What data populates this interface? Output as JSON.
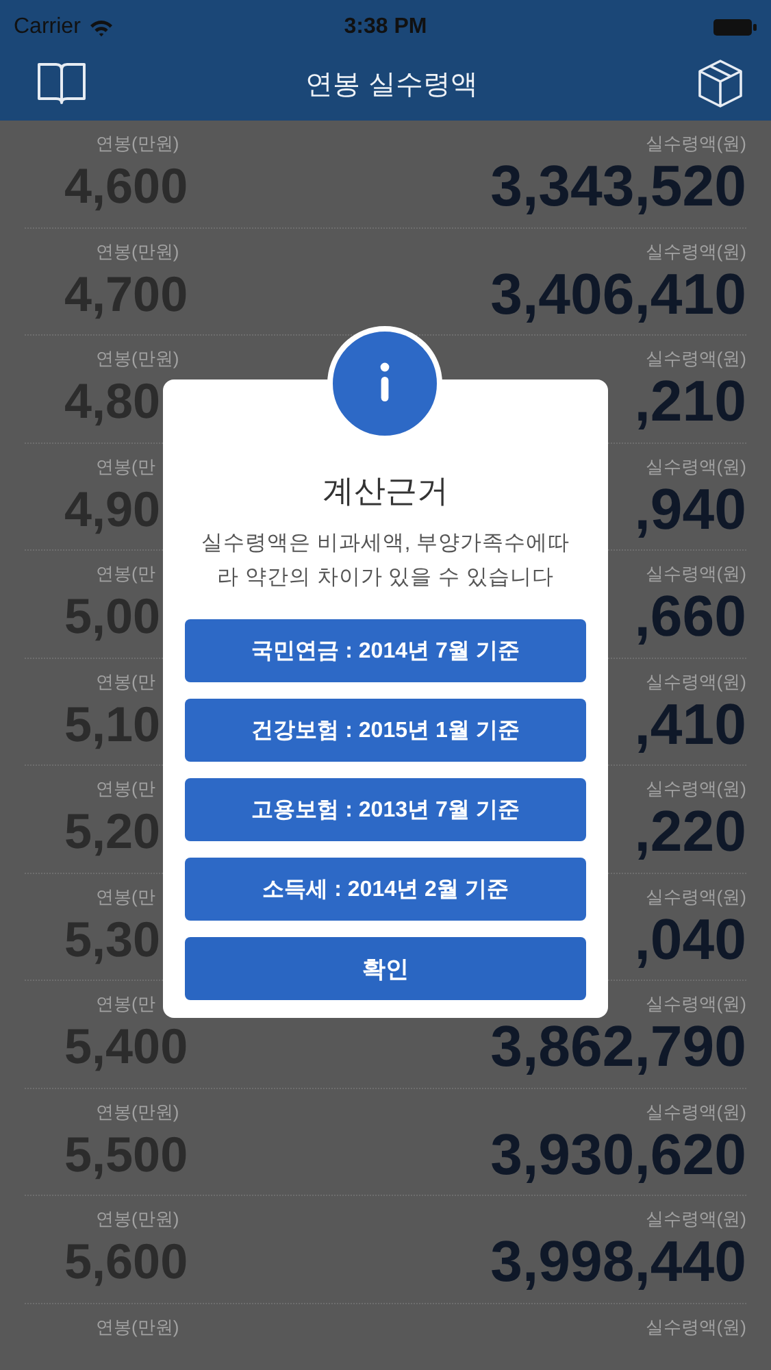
{
  "status_bar": {
    "carrier": "Carrier",
    "time": "3:38 PM"
  },
  "nav": {
    "title": "연봉 실수령액"
  },
  "rows": [
    {
      "salary_label": "연봉(만원)",
      "salary": "4,600",
      "net_label": "실수령액(원)",
      "net": "3,343,520"
    },
    {
      "salary_label": "연봉(만원)",
      "salary": "4,700",
      "net_label": "실수령액(원)",
      "net": "3,406,410"
    },
    {
      "salary_label": "연봉(만원)",
      "salary": "4,80",
      "net_label": "실수령액(원)",
      "net": ",210"
    },
    {
      "salary_label": "연봉(만",
      "salary": "4,90",
      "net_label": "실수령액(원)",
      "net": ",940"
    },
    {
      "salary_label": "연봉(만",
      "salary": "5,00",
      "net_label": "실수령액(원)",
      "net": ",660"
    },
    {
      "salary_label": "연봉(만",
      "salary": "5,10",
      "net_label": "실수령액(원)",
      "net": ",410"
    },
    {
      "salary_label": "연봉(만",
      "salary": "5,20",
      "net_label": "실수령액(원)",
      "net": ",220"
    },
    {
      "salary_label": "연봉(만",
      "salary": "5,30",
      "net_label": "실수령액(원)",
      "net": ",040"
    },
    {
      "salary_label": "연봉(만",
      "salary": "5,400",
      "net_label": "실수령액(원)",
      "net": "3,862,790"
    },
    {
      "salary_label": "연봉(만원)",
      "salary": "5,500",
      "net_label": "실수령액(원)",
      "net": "3,930,620"
    },
    {
      "salary_label": "연봉(만원)",
      "salary": "5,600",
      "net_label": "실수령액(원)",
      "net": "3,998,440"
    },
    {
      "salary_label": "연봉(만원)",
      "net_label": "실수령액(원)"
    }
  ],
  "dialog": {
    "title": "계산근거",
    "message": "실수령액은 비과세액, 부양가족수에따라 약간의 차이가 있을 수 있습니다",
    "buttons": [
      {
        "label": "국민연금 : 2014년 7월 기준",
        "kind": "info"
      },
      {
        "label": "건강보험 : 2015년 1월 기준",
        "kind": "info"
      },
      {
        "label": "고용보험 : 2013년 7월 기준",
        "kind": "info"
      },
      {
        "label": "소득세 : 2014년 2월 기준",
        "kind": "info"
      },
      {
        "label": "확인",
        "kind": "confirm"
      }
    ]
  }
}
